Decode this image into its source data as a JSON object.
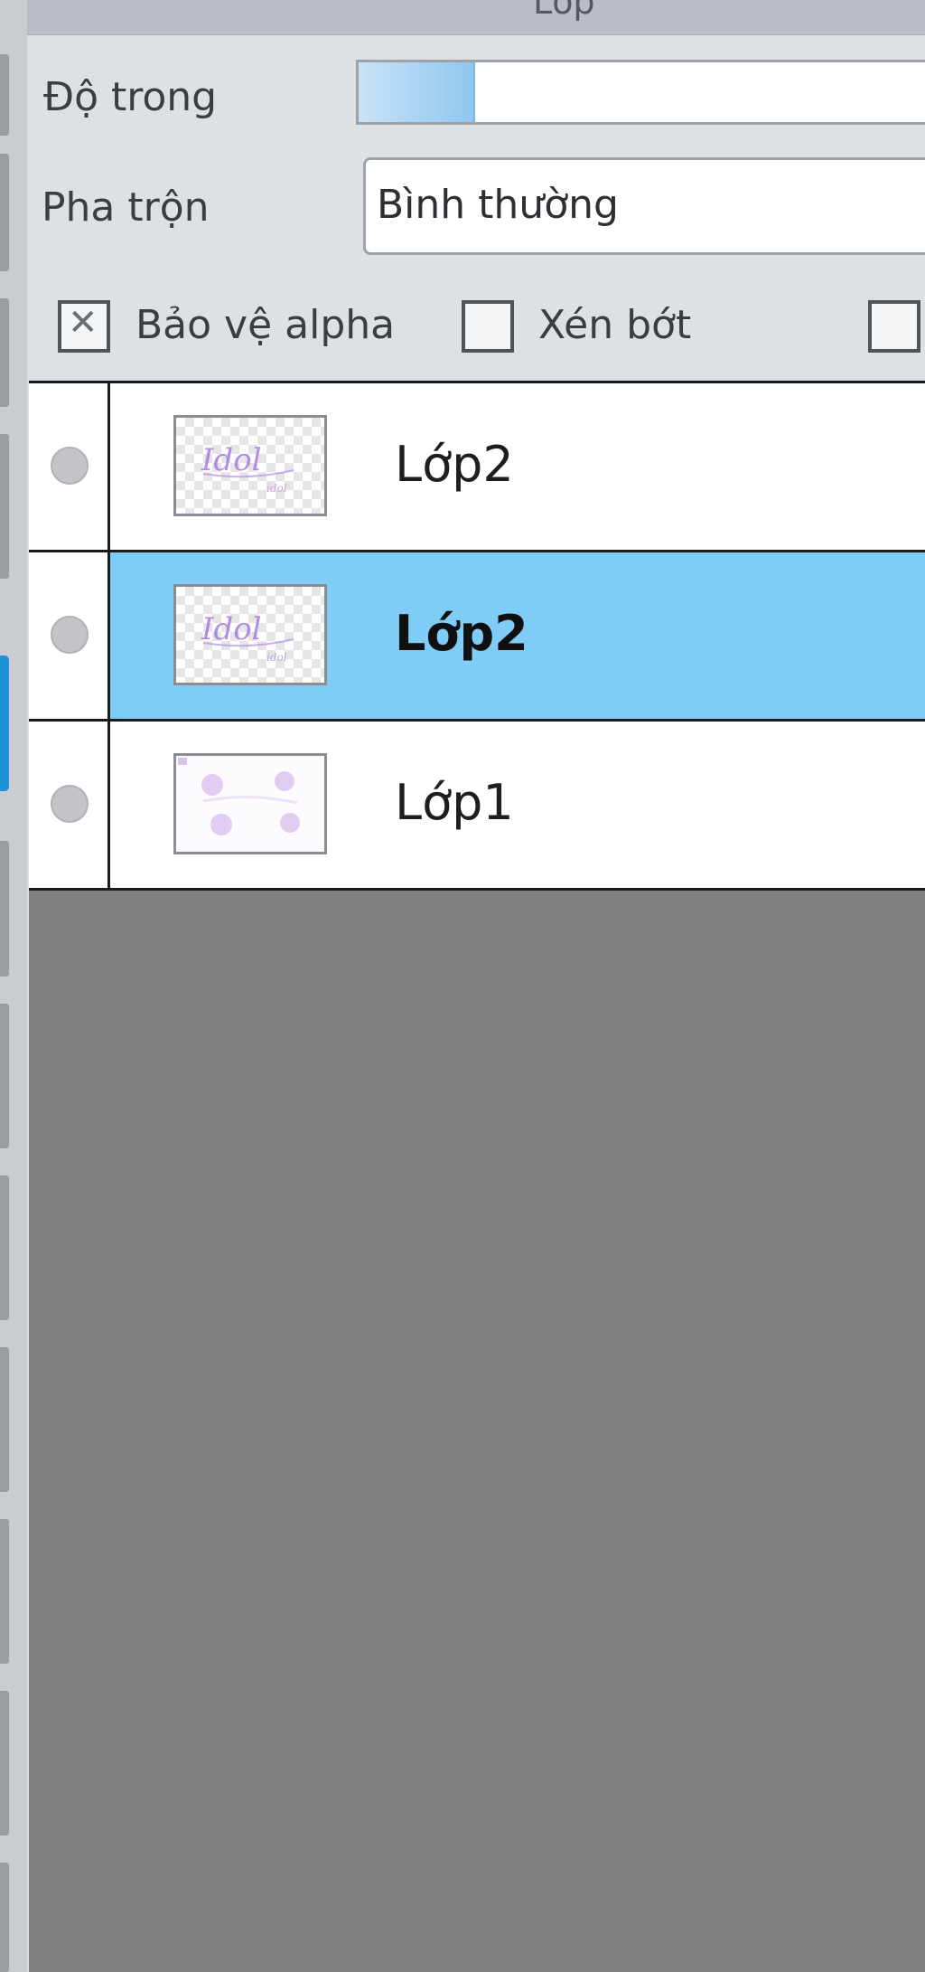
{
  "panel": {
    "title": "Lớp"
  },
  "properties": {
    "opacity_label": "Độ trong",
    "opacity_fraction": 0.2,
    "blend_label": "Pha trộn",
    "blend_value": "Bình thường"
  },
  "options": {
    "protect_alpha_label": "Bảo vệ alpha",
    "protect_alpha_checked": true,
    "clipping_label": "Xén bớt",
    "clipping_checked": false,
    "third_checked": false
  },
  "layers": [
    {
      "name": "Lớp2",
      "selected": false,
      "thumb": "text-art"
    },
    {
      "name": "Lớp2",
      "selected": true,
      "thumb": "text-art"
    },
    {
      "name": "Lớp1",
      "selected": false,
      "thumb": "flower-art"
    }
  ],
  "colors": {
    "selection": "#7fcdf7",
    "accent": "#1e90d6",
    "thumb_art": "#a67be0",
    "list_background": "#7f7f7f"
  },
  "icons": {
    "visibility": "visibility-dot-icon",
    "checkbox_checked": "x-mark-icon"
  }
}
